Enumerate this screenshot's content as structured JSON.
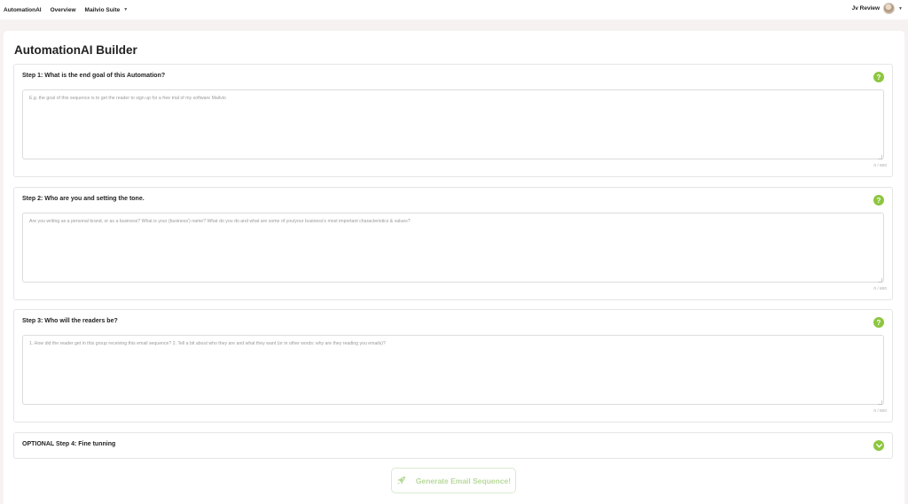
{
  "nav": {
    "items": [
      {
        "label": "AutomationAI"
      },
      {
        "label": "Overview"
      },
      {
        "label": "Mailvio Suite"
      }
    ]
  },
  "user": {
    "name": "Jv Review"
  },
  "page": {
    "title": "AutomationAI Builder"
  },
  "steps": [
    {
      "title": "Step 1: What is the end goal of this Automation?",
      "placeholder": "E.g. the goal of this sequence is to get the reader to sign up for a free trial of my software Mailvio",
      "counter": "0 / 600"
    },
    {
      "title": "Step 2: Who are you and setting the tone.",
      "placeholder": "Are you writing as a personal brand, or as a business? What is your (business') name? What do you do and what are some of you/your business's most important characteristics & values?",
      "counter": "0 / 600"
    },
    {
      "title": "Step 3: Who will the readers be?",
      "placeholder": "1. How did the reader get in this group receiving this email sequence? 2. Tell a bit about who they are and what they want (or in other words: why are they reading you emails)?",
      "counter": "0 / 600"
    }
  ],
  "optional": {
    "title": "OPTIONAL Step 4: Fine tunning"
  },
  "generate": {
    "label": "Generate Email Sequence!"
  },
  "colors": {
    "accent": "#8dc63f",
    "button_text": "#b7d99a",
    "background": "#f7f2f2"
  },
  "icons": {
    "help": "question-icon",
    "expand": "chevron-down-icon",
    "generate": "rocket-icon",
    "caret": "caret-down-icon"
  }
}
